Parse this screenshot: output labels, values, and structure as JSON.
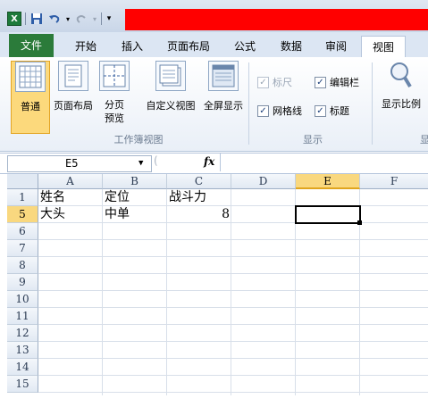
{
  "qat": {
    "app_icon": "X",
    "save_icon": "save-icon",
    "undo_icon": "undo-icon",
    "redo_icon": "redo-icon"
  },
  "tabs": [
    {
      "label": "文件"
    },
    {
      "label": "开始"
    },
    {
      "label": "插入"
    },
    {
      "label": "页面布局"
    },
    {
      "label": "公式"
    },
    {
      "label": "数据"
    },
    {
      "label": "审阅"
    },
    {
      "label": "视图"
    }
  ],
  "ribbon": {
    "views": [
      {
        "label": "普通"
      },
      {
        "label": "页面布局"
      },
      {
        "label": "分页\n预览"
      },
      {
        "label": "自定义视图"
      },
      {
        "label": "全屏显示"
      }
    ],
    "views_group_label": "工作簿视图",
    "show": [
      {
        "label": "标尺",
        "checked": true,
        "enabled": false
      },
      {
        "label": "编辑栏",
        "checked": true,
        "enabled": true
      },
      {
        "label": "网格线",
        "checked": true,
        "enabled": true
      },
      {
        "label": "标题",
        "checked": true,
        "enabled": true
      }
    ],
    "show_group_label": "显示",
    "zoom_label": "显示比例",
    "zoom_group_label": "显"
  },
  "formula_bar": {
    "name_box": "E5",
    "fx": "fx",
    "formula": ""
  },
  "grid": {
    "columns": [
      "A",
      "B",
      "C",
      "D",
      "E",
      "F"
    ],
    "selected_column": "E",
    "rows": [
      "1",
      "5",
      "6",
      "7",
      "8",
      "9",
      "10",
      "11",
      "12",
      "13",
      "14",
      "15"
    ],
    "selected_row": "5",
    "cells": {
      "A1": "姓名",
      "B1": "定位",
      "C1": "战斗力",
      "A5": "大头",
      "B5": "中单",
      "C5": "8"
    },
    "active_cell": "E5"
  }
}
